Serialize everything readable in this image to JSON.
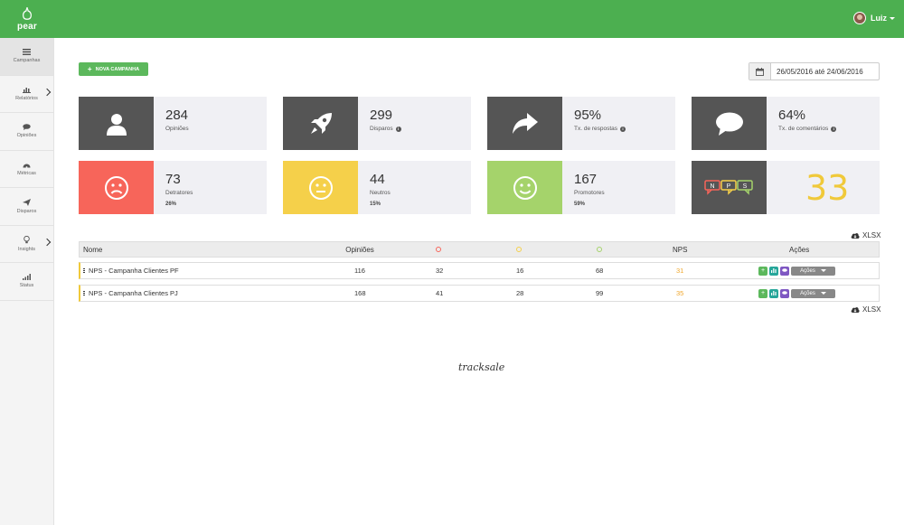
{
  "app": {
    "logo_text": "pear"
  },
  "user": {
    "name": "Luiz"
  },
  "sidebar": {
    "items": [
      {
        "label": "Campanhas",
        "icon": "list-icon",
        "active": true
      },
      {
        "label": "Relatórios",
        "icon": "bar-chart-icon",
        "has_arrow": true
      },
      {
        "label": "Opiniões",
        "icon": "comment-icon"
      },
      {
        "label": "Métricas",
        "icon": "dashboard-icon"
      },
      {
        "label": "Disparos",
        "icon": "send-icon"
      },
      {
        "label": "Insights",
        "icon": "lightbulb-icon",
        "has_arrow": true
      },
      {
        "label": "Status",
        "icon": "signal-icon"
      }
    ]
  },
  "toolbar": {
    "new_campaign_label": "NOVA CAMPANHA",
    "date_range": "26/05/2016 até 24/06/2016"
  },
  "cards": {
    "opinioes": {
      "value": "284",
      "label": "Opiniões"
    },
    "disparos": {
      "value": "299",
      "label": "Disparos"
    },
    "respostas": {
      "value": "95%",
      "label": "Tx. de respostas"
    },
    "comentarios": {
      "value": "64%",
      "label": "Tx. de comentários"
    },
    "detratores": {
      "value": "73",
      "label": "Detratores",
      "pct": "26%"
    },
    "neutros": {
      "value": "44",
      "label": "Neutros",
      "pct": "15%"
    },
    "promotores": {
      "value": "167",
      "label": "Promotores",
      "pct": "59%"
    },
    "nps": {
      "value": "33",
      "badge_letters": [
        "N",
        "P",
        "S"
      ]
    }
  },
  "export": {
    "label": "XLSX"
  },
  "table": {
    "headers": {
      "name": "Nome",
      "opinions": "Opiniões",
      "nps": "NPS",
      "actions": "Ações"
    },
    "rows": [
      {
        "name": "NPS - Campanha Clientes PF",
        "opinions": "116",
        "detractors": "32",
        "neutrals": "16",
        "promoters": "68",
        "nps": "31",
        "actions_label": "Ações"
      },
      {
        "name": "NPS - Campanha Clientes PJ",
        "opinions": "168",
        "detractors": "41",
        "neutrals": "28",
        "promoters": "99",
        "nps": "35",
        "actions_label": "Ações"
      }
    ]
  },
  "footer": {
    "brand": "tracksale"
  },
  "colors": {
    "topbar": "#4caf50",
    "detractor": "#f7655a",
    "neutral": "#f5d04a",
    "promoter": "#a5d36b",
    "dark_tile": "#555555",
    "nps_number": "#f0c93a"
  }
}
